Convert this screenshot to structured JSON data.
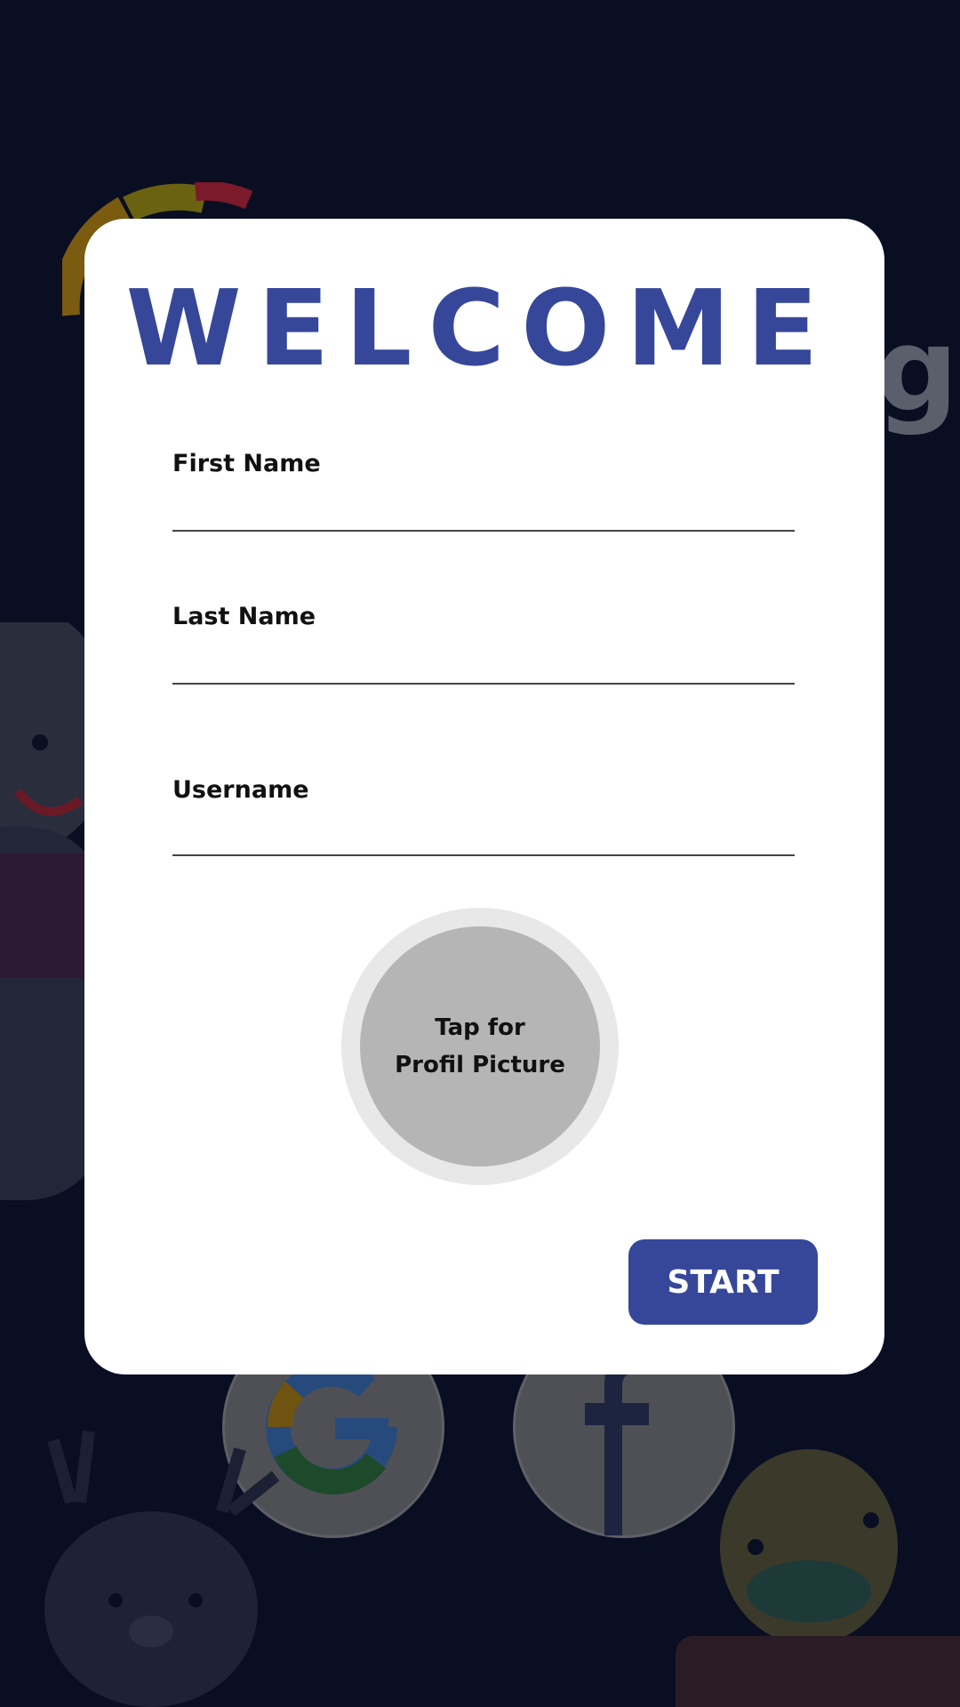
{
  "form": {
    "title": "WELCOME",
    "first_name_label": "First Name",
    "first_name_value": "",
    "last_name_label": "Last Name",
    "last_name_value": "",
    "username_label": "Username",
    "username_value": "",
    "avatar_line1": "Tap for",
    "avatar_line2": "Profil Picture",
    "start_label": "START"
  },
  "colors": {
    "background": "#0a0e22",
    "accent": "#36479a",
    "card": "#ffffff",
    "avatar_fill": "#b5b5b5"
  },
  "background_icons": [
    "google-icon",
    "facebook-icon",
    "mascot-llama",
    "mascot-deer",
    "mascot-chick",
    "app-logo-arc"
  ]
}
